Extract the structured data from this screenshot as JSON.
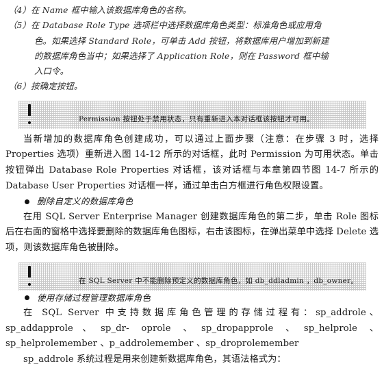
{
  "document": {
    "type": "scanned-book-page",
    "language": "zh-CN",
    "topic": "SQL Server 数据库角色管理"
  },
  "steps": [
    {
      "name": "step-4",
      "lines": [
        "（4）在 Name 框中输入该数据库角色的名称。"
      ]
    },
    {
      "name": "step-5",
      "lines": [
        "（5）在 Database Role Type 选项栏中选择数据库角色类型：标准角色或应用角",
        "色。如果选择 Standard Role，可单击 Add 按钮，将数据库用户增加到新建",
        "的数据库角色当中；如果选择了 Application Role，则在 Password 框中输",
        "入口令。"
      ]
    },
    {
      "name": "step-6",
      "lines": [
        "（6）按确定按钮。"
      ]
    }
  ],
  "note_1": {
    "icon": "exclamation-icon",
    "text": "Permission 按钮处于禁用状态，只有重新进入本对话框该按钮才可用。"
  },
  "note_2": {
    "icon": "exclamation-icon",
    "text": "在 SQL Server 中不能删除预定义的数据库角色，如 db_ddladmin ，db_owner。"
  },
  "paragraph_1": "当新增加的数据库角色创建成功，可以通过上面步骤（注意：在步骤 3 时，选择 Properties 选项）重新进入图 14-12 所示的对话框，此时 Permission 为可用状态。单击按钮弹出 Database Role Properties 对话框，该对话框与本章第四节图 14-7 所示的 Database User Properties 对话框一样，通过单击白方框进行角色权限设置。",
  "bullet_1": "删除自定义的数据库角色",
  "paragraph_2": "在用 SQL Server Enterprise Manager 创建数据库角色的第二步，单击 Role 图标后在右面的窗格中选择要删除的数据库角色图标，右击该图标，在弹出菜单中选择 Delete 选项，则该数据库角色被删除。",
  "bullet_2": "使用存储过程管理数据库角色",
  "paragraph_3": "在 SQL Server 中支持数据库角色管理的存储过程有：sp_addrole、sp_addapprole、sp_dr- oprole 、sp_dropapprole 、sp_helprole 、sp_helprolemember 、p_addrolemember 、sp_droprolemember",
  "paragraph_4": "sp_addrole 系统过程是用来创建新数据库角色，其语法格式为："
}
